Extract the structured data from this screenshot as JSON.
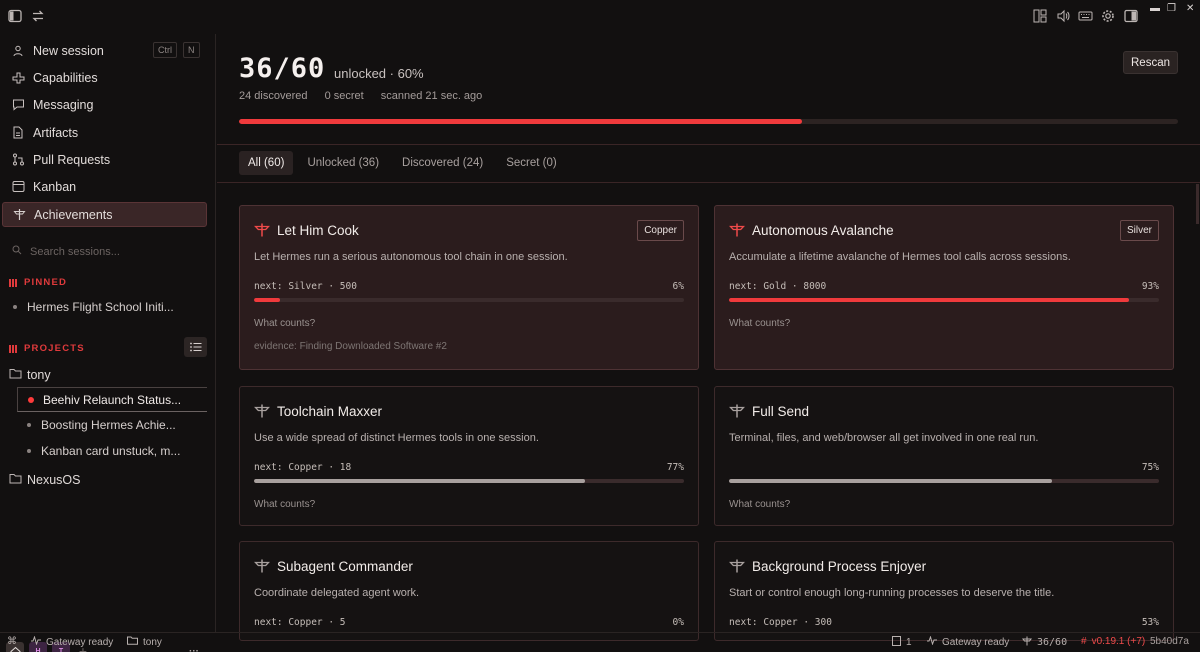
{
  "topbar": {
    "left_icons": [
      "sidebar-toggle-icon",
      "swap-arrows-icon"
    ],
    "right_icons": [
      "layout-icon",
      "volume-icon",
      "keyboard-icon",
      "gear-icon",
      "panel-icon"
    ],
    "window_controls": [
      "minimize",
      "restore",
      "close"
    ]
  },
  "sidebar": {
    "nav": [
      {
        "label": "New session",
        "icon": "user-icon"
      },
      {
        "label": "Capabilities",
        "icon": "capabilities-icon"
      },
      {
        "label": "Messaging",
        "icon": "message-icon"
      },
      {
        "label": "Artifacts",
        "icon": "file-icon"
      },
      {
        "label": "Pull Requests",
        "icon": "pull-request-icon"
      },
      {
        "label": "Kanban",
        "icon": "kanban-icon"
      },
      {
        "label": "Achievements",
        "icon": "trophy-icon",
        "active": true
      }
    ],
    "shortcut_keys": [
      "Ctrl",
      "N"
    ],
    "search_placeholder": "Search sessions...",
    "pinned_title": "PINNED",
    "pinned": [
      "Hermes Flight School Initi..."
    ],
    "projects_title": "PROJECTS",
    "projects": [
      {
        "name": "tony",
        "sessions": [
          "Beehiv Relaunch Status...",
          "Boosting Hermes Achie...",
          "Kanban card unstuck, m..."
        ]
      },
      {
        "name": "NexusOS",
        "sessions": []
      }
    ],
    "workspaces": [
      "H",
      "T"
    ],
    "add_label": "+",
    "more_label": "···"
  },
  "header": {
    "count": "36/60",
    "unlocked_text": "unlocked · 60%",
    "discovered": "24 discovered",
    "secret": "0 secret",
    "scanned": "scanned 21 sec. ago",
    "rescan_label": "Rescan",
    "progress": 0.6
  },
  "tabs": [
    "All (60)",
    "Unlocked (36)",
    "Discovered (24)",
    "Secret (0)"
  ],
  "cards": [
    {
      "title": "Let Him Cook",
      "tier": "Copper",
      "desc": "Let Hermes run a serious autonomous tool chain in one session.",
      "next": "next: Silver · 500",
      "pct": "6%",
      "progress": 0.06,
      "what": "What counts?",
      "evidence": "evidence: Finding Downloaded Software #2",
      "unlocked": true
    },
    {
      "title": "Autonomous Avalanche",
      "tier": "Silver",
      "desc": "Accumulate a lifetime avalanche of Hermes tool calls across sessions.",
      "next": "next: Gold · 8000",
      "pct": "93%",
      "progress": 0.93,
      "what": "What counts?",
      "evidence": "",
      "unlocked": true
    },
    {
      "title": "Toolchain Maxxer",
      "tier": "",
      "desc": "Use a wide spread of distinct Hermes tools in one session.",
      "next": "next: Copper · 18",
      "pct": "77%",
      "progress": 0.77,
      "what": "What counts?",
      "evidence": "",
      "unlocked": false
    },
    {
      "title": "Full Send",
      "tier": "",
      "desc": "Terminal, files, and web/browser all get involved in one real run.",
      "next": "",
      "pct": "75%",
      "progress": 0.75,
      "what": "What counts?",
      "evidence": "",
      "unlocked": false
    },
    {
      "title": "Subagent Commander",
      "tier": "",
      "desc": "Coordinate delegated agent work.",
      "next": "next: Copper · 5",
      "pct": "0%",
      "progress": 0,
      "what": "",
      "evidence": "",
      "unlocked": false
    },
    {
      "title": "Background Process Enjoyer",
      "tier": "",
      "desc": "Start or control enough long-running processes to deserve the title.",
      "next": "next: Copper · 300",
      "pct": "53%",
      "progress": 0.53,
      "what": "",
      "evidence": "",
      "unlocked": false
    }
  ],
  "statusbar": {
    "gateway_left": "Gateway ready",
    "folder": "tony",
    "sessions_count": "1",
    "gateway_right": "Gateway ready",
    "achievements": "36/60",
    "version": "v0.19.1 (+7)",
    "commit": "5b40d7a"
  },
  "colors": {
    "accent": "#f03a3c",
    "bar_neutral": "#a8a09e",
    "background": "#121010"
  }
}
